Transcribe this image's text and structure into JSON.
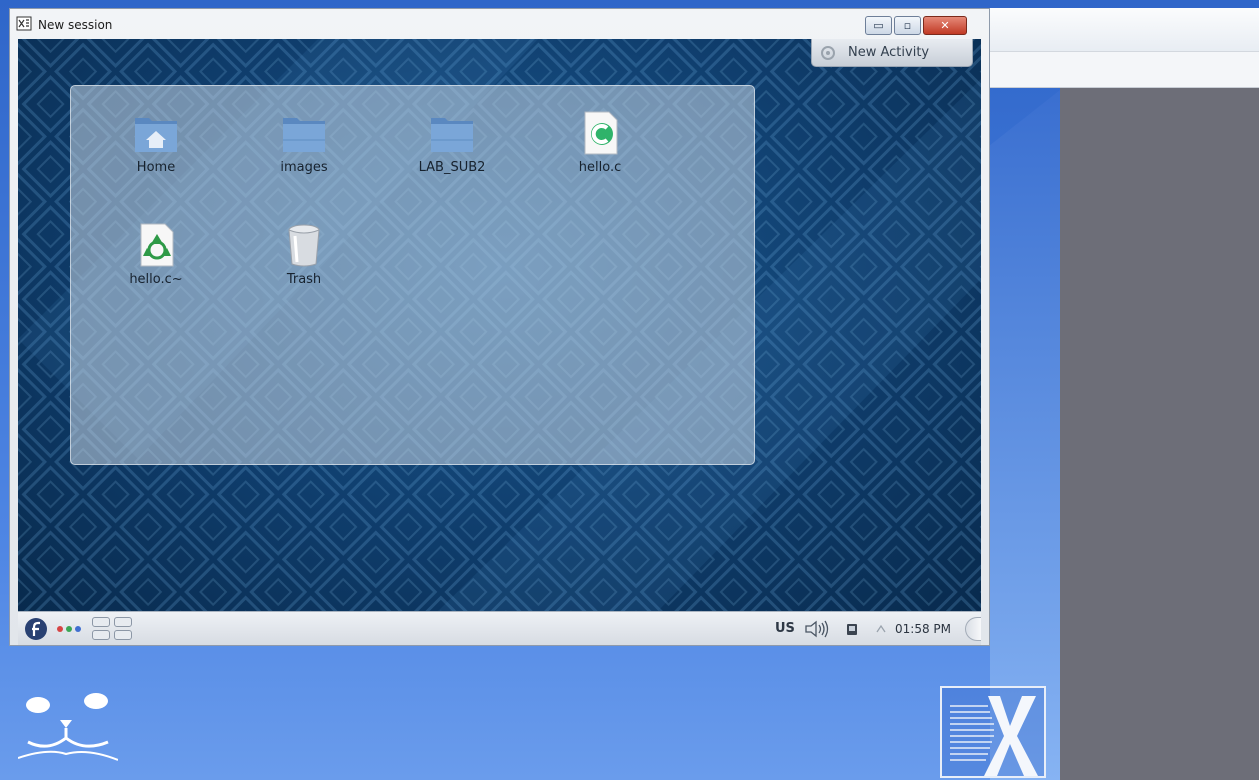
{
  "window": {
    "title": "New session",
    "minimize_symbol": "▭",
    "maximize_symbol": "▫",
    "close_symbol": "✕"
  },
  "activity": {
    "label": "New Activity"
  },
  "folderview": {
    "items": [
      {
        "label": "Home",
        "icon": "home-folder-icon"
      },
      {
        "label": "images",
        "icon": "folder-icon"
      },
      {
        "label": "LAB_SUB2",
        "icon": "folder-icon"
      },
      {
        "label": "hello.c",
        "icon": "c-source-file-icon"
      },
      {
        "label": "hello.c~",
        "icon": "backup-file-icon"
      },
      {
        "label": "Trash",
        "icon": "trash-icon"
      }
    ]
  },
  "panel": {
    "keyboard_layout": "US",
    "clock": "01:58 PM"
  },
  "colors": {
    "desktop_blue": "#0f3d6c",
    "host_blue": "#4f86e4",
    "host_gray": "#6d6e78"
  }
}
